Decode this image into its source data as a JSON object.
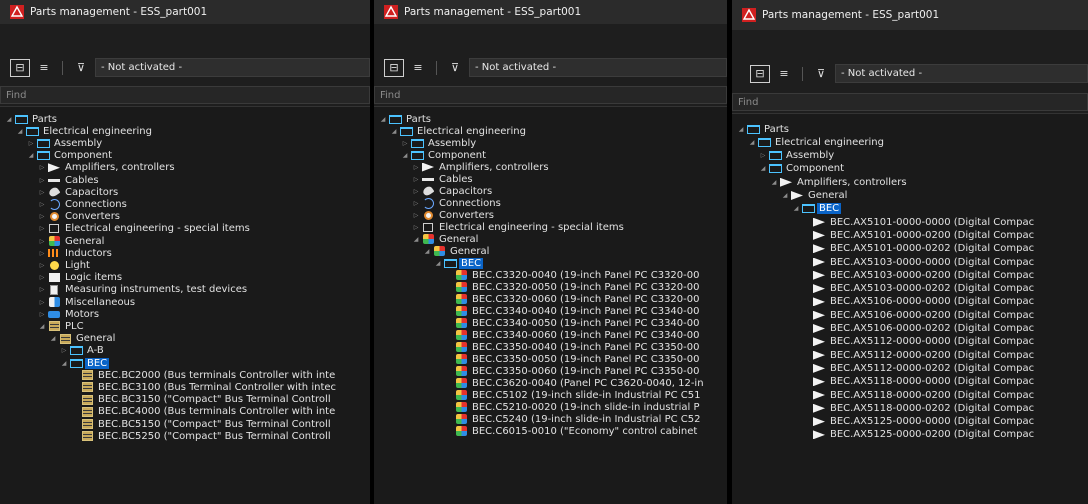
{
  "window_title": "Parts management - ESS_part001",
  "filter_value": "- Not activated -",
  "find_placeholder": "Find",
  "colors": {
    "title_bar": "#2b2b2b",
    "selection": "#0a64c8",
    "folder": "#4cc3ff",
    "app_icon": "#d02020"
  },
  "panels": [
    {
      "rows": [
        {
          "label": "Parts",
          "icon": "folder-icon",
          "depth": 0,
          "expanded": true
        },
        {
          "label": "Electrical engineering",
          "icon": "folder-icon",
          "depth": 1,
          "expanded": true
        },
        {
          "label": "Assembly",
          "icon": "folder-icon",
          "depth": 2,
          "expanded": false
        },
        {
          "label": "Component",
          "icon": "folder-icon",
          "depth": 2,
          "expanded": true
        },
        {
          "label": "Amplifiers, controllers",
          "icon": "amplifier-icon",
          "depth": 3,
          "expanded": false
        },
        {
          "label": "Cables",
          "icon": "cable-icon",
          "depth": 3,
          "expanded": false
        },
        {
          "label": "Capacitors",
          "icon": "capacitor-icon",
          "depth": 3,
          "expanded": false
        },
        {
          "label": "Connections",
          "icon": "connection-icon",
          "depth": 3,
          "expanded": false
        },
        {
          "label": "Converters",
          "icon": "converter-icon",
          "depth": 3,
          "expanded": false
        },
        {
          "label": "Electrical engineering - special items",
          "icon": "special-items-icon",
          "depth": 3,
          "expanded": false
        },
        {
          "label": "General",
          "icon": "general-icon",
          "depth": 3,
          "expanded": false
        },
        {
          "label": "Inductors",
          "icon": "inductor-icon",
          "depth": 3,
          "expanded": false
        },
        {
          "label": "Light",
          "icon": "light-bulb-icon",
          "depth": 3,
          "expanded": false
        },
        {
          "label": "Logic items",
          "icon": "logic-icon",
          "depth": 3,
          "expanded": false
        },
        {
          "label": "Measuring instruments, test devices",
          "icon": "measuring-icon",
          "depth": 3,
          "expanded": false
        },
        {
          "label": "Miscellaneous",
          "icon": "misc-icon",
          "depth": 3,
          "expanded": false
        },
        {
          "label": "Motors",
          "icon": "motor-icon",
          "depth": 3,
          "expanded": false
        },
        {
          "label": "PLC",
          "icon": "plc-icon",
          "depth": 3,
          "expanded": true
        },
        {
          "label": "General",
          "icon": "plc-icon",
          "depth": 4,
          "expanded": true
        },
        {
          "label": "A-B",
          "icon": "folder-icon",
          "depth": 5,
          "expanded": false
        },
        {
          "label": "BEC",
          "icon": "folder-icon",
          "depth": 5,
          "expanded": true,
          "selected": true
        },
        {
          "label": "BEC.BC2000 (Bus terminals Controller with inte",
          "icon": "plc-icon",
          "depth": 6,
          "leaf": true
        },
        {
          "label": "BEC.BC3100 (Bus Terminal Controller with intec",
          "icon": "plc-icon",
          "depth": 6,
          "leaf": true
        },
        {
          "label": "BEC.BC3150 (\"Compact\" Bus Terminal Controll",
          "icon": "plc-icon",
          "depth": 6,
          "leaf": true
        },
        {
          "label": "BEC.BC4000 (Bus terminals Controller with inte",
          "icon": "plc-icon",
          "depth": 6,
          "leaf": true
        },
        {
          "label": "BEC.BC5150 (\"Compact\" Bus Terminal Controll",
          "icon": "plc-icon",
          "depth": 6,
          "leaf": true
        },
        {
          "label": "BEC.BC5250 (\"Compact\" Bus Terminal Controll",
          "icon": "plc-icon",
          "depth": 6,
          "leaf": true
        }
      ]
    },
    {
      "rows": [
        {
          "label": "Parts",
          "icon": "folder-icon",
          "depth": 0,
          "expanded": true
        },
        {
          "label": "Electrical engineering",
          "icon": "folder-icon",
          "depth": 1,
          "expanded": true
        },
        {
          "label": "Assembly",
          "icon": "folder-icon",
          "depth": 2,
          "expanded": false
        },
        {
          "label": "Component",
          "icon": "folder-icon",
          "depth": 2,
          "expanded": true
        },
        {
          "label": "Amplifiers, controllers",
          "icon": "amplifier-icon",
          "depth": 3,
          "expanded": false
        },
        {
          "label": "Cables",
          "icon": "cable-icon",
          "depth": 3,
          "expanded": false
        },
        {
          "label": "Capacitors",
          "icon": "capacitor-icon",
          "depth": 3,
          "expanded": false
        },
        {
          "label": "Connections",
          "icon": "connection-icon",
          "depth": 3,
          "expanded": false
        },
        {
          "label": "Converters",
          "icon": "converter-icon",
          "depth": 3,
          "expanded": false
        },
        {
          "label": "Electrical engineering - special items",
          "icon": "special-items-icon",
          "depth": 3,
          "expanded": false
        },
        {
          "label": "General",
          "icon": "general-icon",
          "depth": 3,
          "expanded": true
        },
        {
          "label": "General",
          "icon": "general-icon",
          "depth": 4,
          "expanded": true
        },
        {
          "label": "BEC",
          "icon": "folder-icon",
          "depth": 5,
          "expanded": true,
          "selected": true
        },
        {
          "label": "BEC.C3320-0040 (19-inch Panel PC C3320-00",
          "icon": "general-icon",
          "depth": 6,
          "leaf": true
        },
        {
          "label": "BEC.C3320-0050 (19-inch Panel PC C3320-00",
          "icon": "general-icon",
          "depth": 6,
          "leaf": true
        },
        {
          "label": "BEC.C3320-0060 (19-inch Panel PC C3320-00",
          "icon": "general-icon",
          "depth": 6,
          "leaf": true
        },
        {
          "label": "BEC.C3340-0040 (19-inch Panel PC C3340-00",
          "icon": "general-icon",
          "depth": 6,
          "leaf": true
        },
        {
          "label": "BEC.C3340-0050 (19-inch Panel PC C3340-00",
          "icon": "general-icon",
          "depth": 6,
          "leaf": true
        },
        {
          "label": "BEC.C3340-0060 (19-inch Panel PC C3340-00",
          "icon": "general-icon",
          "depth": 6,
          "leaf": true
        },
        {
          "label": "BEC.C3350-0040 (19-inch Panel PC C3350-00",
          "icon": "general-icon",
          "depth": 6,
          "leaf": true
        },
        {
          "label": "BEC.C3350-0050 (19-inch Panel PC C3350-00",
          "icon": "general-icon",
          "depth": 6,
          "leaf": true
        },
        {
          "label": "BEC.C3350-0060 (19-inch Panel PC C3350-00",
          "icon": "general-icon",
          "depth": 6,
          "leaf": true
        },
        {
          "label": "BEC.C3620-0040 (Panel PC C3620-0040, 12-in",
          "icon": "general-icon",
          "depth": 6,
          "leaf": true
        },
        {
          "label": "BEC.C5102 (19-inch slide-in Industrial PC C51",
          "icon": "general-icon",
          "depth": 6,
          "leaf": true
        },
        {
          "label": "BEC.C5210-0020 (19-inch slide-in industrial P",
          "icon": "general-icon",
          "depth": 6,
          "leaf": true
        },
        {
          "label": "BEC.C5240 (19-inch slide-in Industrial PC C52",
          "icon": "general-icon",
          "depth": 6,
          "leaf": true
        },
        {
          "label": "BEC.C6015-0010 (\"Economy\" control cabinet",
          "icon": "general-icon",
          "depth": 6,
          "leaf": true
        }
      ]
    },
    {
      "rows": [
        {
          "label": "Parts",
          "icon": "folder-icon",
          "depth": 0,
          "expanded": true
        },
        {
          "label": "Electrical engineering",
          "icon": "folder-icon",
          "depth": 1,
          "expanded": true
        },
        {
          "label": "Assembly",
          "icon": "folder-icon",
          "depth": 2,
          "expanded": false
        },
        {
          "label": "Component",
          "icon": "folder-icon",
          "depth": 2,
          "expanded": true
        },
        {
          "label": "Amplifiers, controllers",
          "icon": "amplifier-icon",
          "depth": 3,
          "expanded": true
        },
        {
          "label": "General",
          "icon": "amplifier-icon",
          "depth": 4,
          "expanded": true
        },
        {
          "label": "BEC",
          "icon": "folder-icon",
          "depth": 5,
          "expanded": true,
          "selected": true
        },
        {
          "label": "BEC.AX5101-0000-0000 (Digital Compac",
          "icon": "amplifier-icon",
          "depth": 6,
          "leaf": true
        },
        {
          "label": "BEC.AX5101-0000-0200 (Digital Compac",
          "icon": "amplifier-icon",
          "depth": 6,
          "leaf": true
        },
        {
          "label": "BEC.AX5101-0000-0202 (Digital Compac",
          "icon": "amplifier-icon",
          "depth": 6,
          "leaf": true
        },
        {
          "label": "BEC.AX5103-0000-0000 (Digital Compac",
          "icon": "amplifier-icon",
          "depth": 6,
          "leaf": true
        },
        {
          "label": "BEC.AX5103-0000-0200 (Digital Compac",
          "icon": "amplifier-icon",
          "depth": 6,
          "leaf": true
        },
        {
          "label": "BEC.AX5103-0000-0202 (Digital Compac",
          "icon": "amplifier-icon",
          "depth": 6,
          "leaf": true
        },
        {
          "label": "BEC.AX5106-0000-0000 (Digital Compac",
          "icon": "amplifier-icon",
          "depth": 6,
          "leaf": true
        },
        {
          "label": "BEC.AX5106-0000-0200 (Digital Compac",
          "icon": "amplifier-icon",
          "depth": 6,
          "leaf": true
        },
        {
          "label": "BEC.AX5106-0000-0202 (Digital Compac",
          "icon": "amplifier-icon",
          "depth": 6,
          "leaf": true
        },
        {
          "label": "BEC.AX5112-0000-0000 (Digital Compac",
          "icon": "amplifier-icon",
          "depth": 6,
          "leaf": true
        },
        {
          "label": "BEC.AX5112-0000-0200 (Digital Compac",
          "icon": "amplifier-icon",
          "depth": 6,
          "leaf": true
        },
        {
          "label": "BEC.AX5112-0000-0202 (Digital Compac",
          "icon": "amplifier-icon",
          "depth": 6,
          "leaf": true
        },
        {
          "label": "BEC.AX5118-0000-0000 (Digital Compac",
          "icon": "amplifier-icon",
          "depth": 6,
          "leaf": true
        },
        {
          "label": "BEC.AX5118-0000-0200 (Digital Compac",
          "icon": "amplifier-icon",
          "depth": 6,
          "leaf": true
        },
        {
          "label": "BEC.AX5118-0000-0202 (Digital Compac",
          "icon": "amplifier-icon",
          "depth": 6,
          "leaf": true
        },
        {
          "label": "BEC.AX5125-0000-0000 (Digital Compac",
          "icon": "amplifier-icon",
          "depth": 6,
          "leaf": true
        },
        {
          "label": "BEC.AX5125-0000-0200 (Digital Compac",
          "icon": "amplifier-icon",
          "depth": 6,
          "leaf": true
        }
      ]
    }
  ]
}
